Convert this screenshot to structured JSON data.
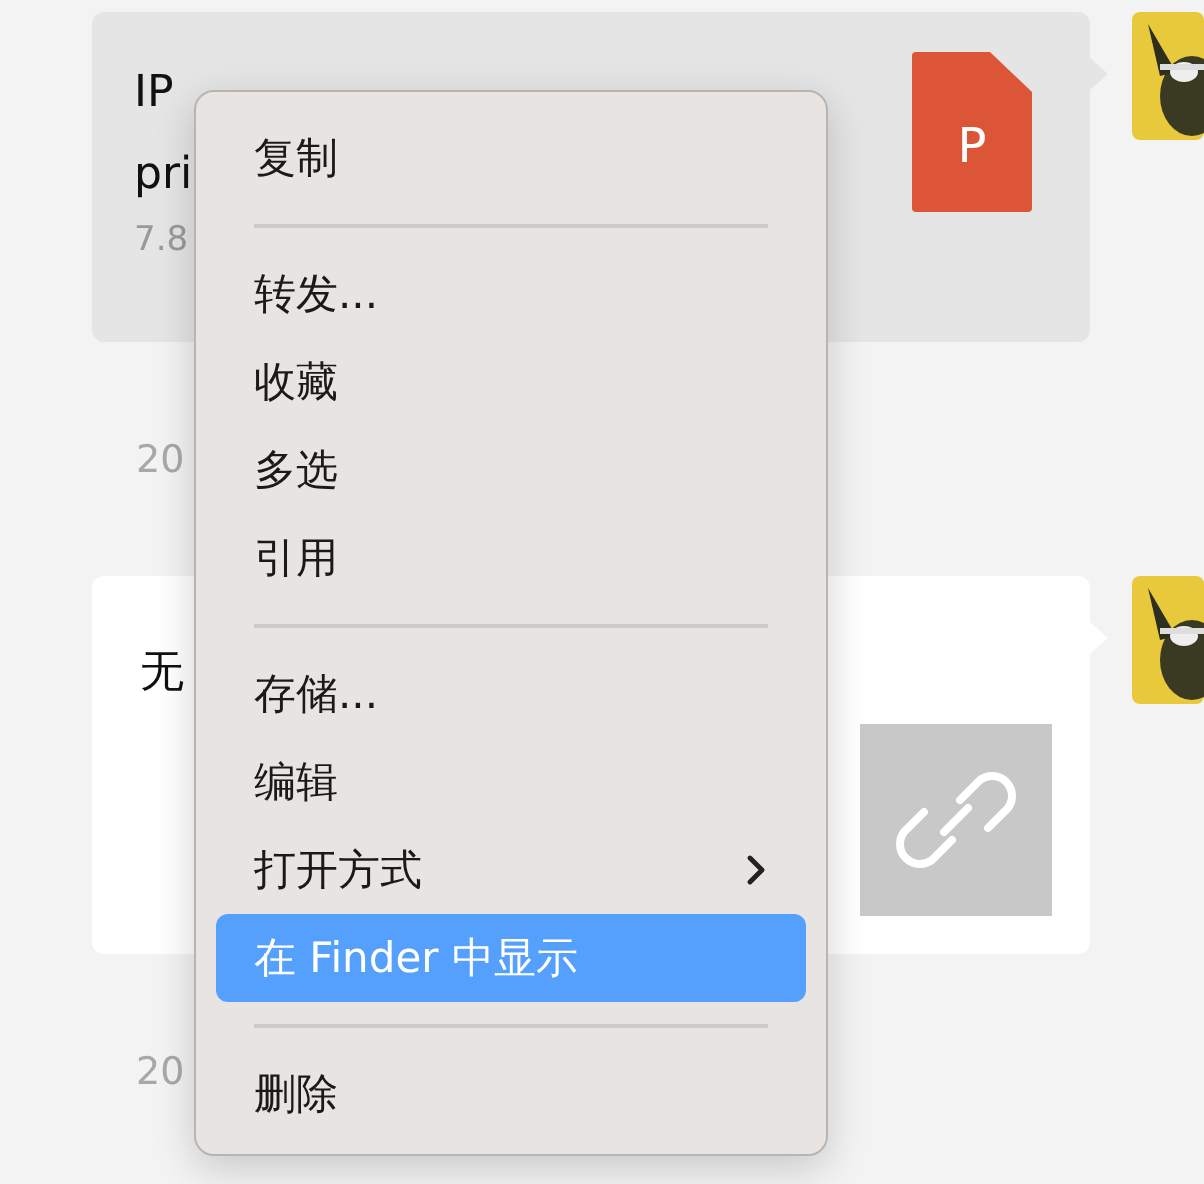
{
  "messages": [
    {
      "kind": "file",
      "lines": [
        "IP",
        "pri"
      ],
      "meta": "7.8",
      "file_icon_letter": "P"
    },
    {
      "kind": "timestamp",
      "text": "20"
    },
    {
      "kind": "link",
      "lines": [
        "无"
      ]
    },
    {
      "kind": "timestamp",
      "text": "20"
    }
  ],
  "context_menu": {
    "items": [
      {
        "kind": "item",
        "label": "复制",
        "selected": false,
        "has_submenu": false
      },
      {
        "kind": "separator"
      },
      {
        "kind": "item",
        "label": "转发...",
        "selected": false,
        "has_submenu": false
      },
      {
        "kind": "item",
        "label": "收藏",
        "selected": false,
        "has_submenu": false
      },
      {
        "kind": "item",
        "label": "多选",
        "selected": false,
        "has_submenu": false
      },
      {
        "kind": "item",
        "label": "引用",
        "selected": false,
        "has_submenu": false
      },
      {
        "kind": "separator"
      },
      {
        "kind": "item",
        "label": "存储...",
        "selected": false,
        "has_submenu": false
      },
      {
        "kind": "item",
        "label": "编辑",
        "selected": false,
        "has_submenu": false
      },
      {
        "kind": "item",
        "label": "打开方式",
        "selected": false,
        "has_submenu": true
      },
      {
        "kind": "item",
        "label": "在 Finder 中显示",
        "selected": true,
        "has_submenu": false
      },
      {
        "kind": "separator"
      },
      {
        "kind": "item",
        "label": "删除",
        "selected": false,
        "has_submenu": false
      }
    ]
  }
}
